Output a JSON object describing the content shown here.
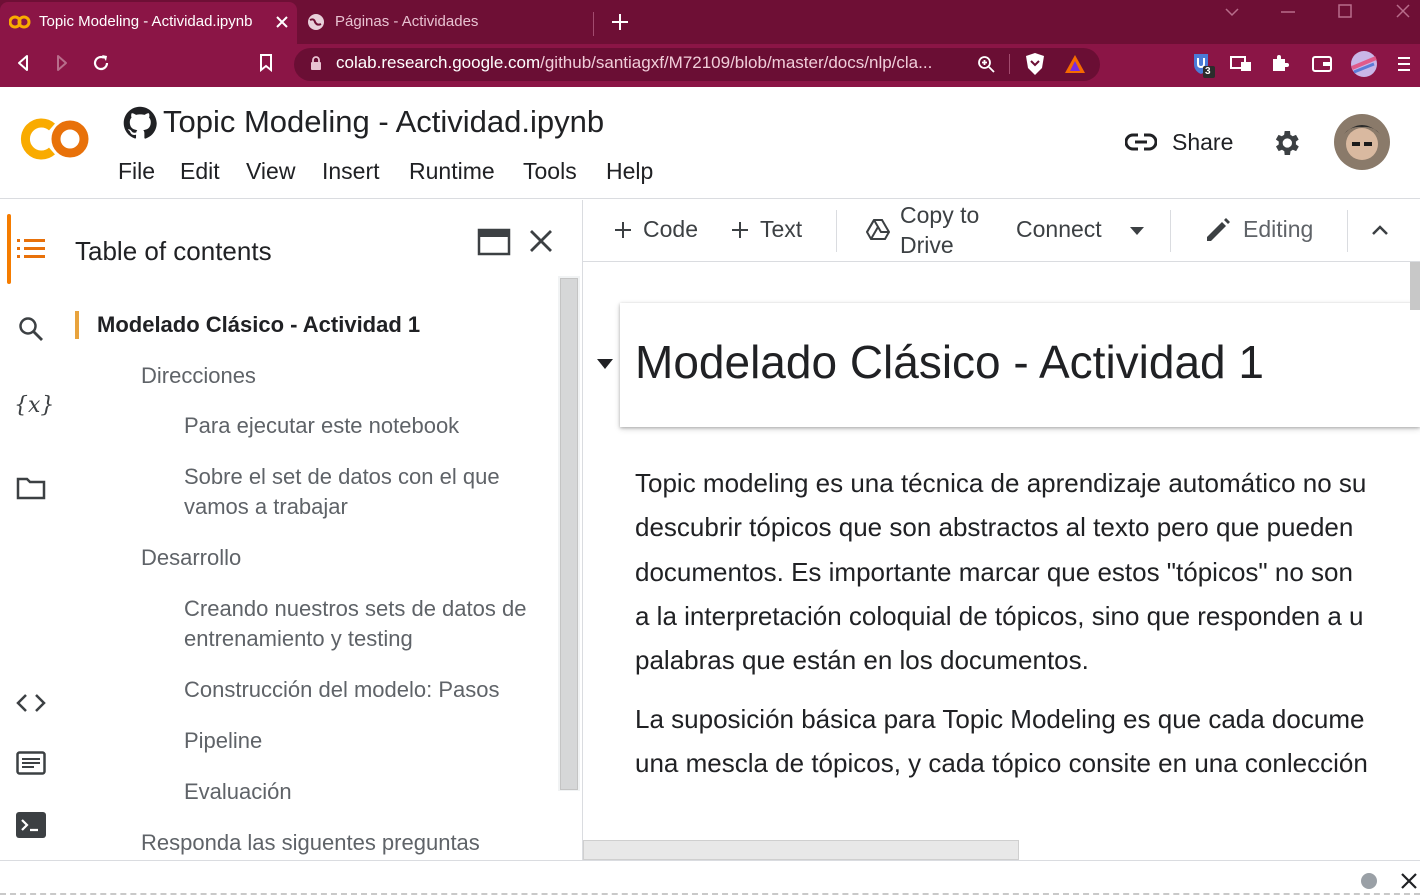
{
  "browser": {
    "tabs": [
      {
        "title": "Topic Modeling - Actividad.ipynb",
        "active": true
      },
      {
        "title": "Páginas - Actividades",
        "active": false
      }
    ],
    "url_host": "colab.research.google.com",
    "url_path": "/github/santiagxf/M72109/blob/master/docs/nlp/cla...",
    "extension_badge": "3"
  },
  "colab": {
    "logo_text": "CO",
    "notebook_title": "Topic Modeling - Actividad.ipynb",
    "menu": [
      "File",
      "Edit",
      "View",
      "Insert",
      "Runtime",
      "Tools",
      "Help"
    ],
    "share_label": "Share"
  },
  "toc": {
    "title": "Table of contents",
    "items": [
      {
        "label": "Modelado Clásico - Actividad 1",
        "level": 1
      },
      {
        "label": "Direcciones",
        "level": 2
      },
      {
        "label": "Para ejecutar este notebook",
        "level": 3
      },
      {
        "label": "Sobre el set de datos con el que vamos a trabajar",
        "level": 3
      },
      {
        "label": "Desarrollo",
        "level": 2
      },
      {
        "label": "Creando nuestros sets de datos de entrenamiento y testing",
        "level": 3
      },
      {
        "label": "Construcción del modelo: Pasos",
        "level": 3
      },
      {
        "label": "Pipeline",
        "level": 3
      },
      {
        "label": "Evaluación",
        "level": 3
      },
      {
        "label": "Responda las siguentes preguntas",
        "level": 2
      }
    ]
  },
  "toolbar": {
    "code_label": "Code",
    "text_label": "Text",
    "copy_line1": "Copy to",
    "copy_line2": "Drive",
    "connect_label": "Connect",
    "editing_label": "Editing"
  },
  "notebook": {
    "heading": "Modelado Clásico - Actividad 1",
    "paragraph1": [
      "Topic modeling es una técnica de aprendizaje automático no su",
      "descubrir tópicos que son abstractos al texto pero que pueden",
      "documentos. Es importante marcar que estos \"tópicos\" no son",
      "a la interpretación coloquial de tópicos, sino que responden a u",
      "palabras que están en los documentos."
    ],
    "paragraph2": [
      "La suposición básica para Topic Modeling es que cada docume",
      "una mescla de tópicos, y cada tópico consite en una conlección"
    ]
  },
  "colors": {
    "tab_bar": "#6e0f35",
    "active_tab": "#8b1546",
    "colab_orange": "#f9ab00",
    "toc_marker": "#e8a33d"
  }
}
